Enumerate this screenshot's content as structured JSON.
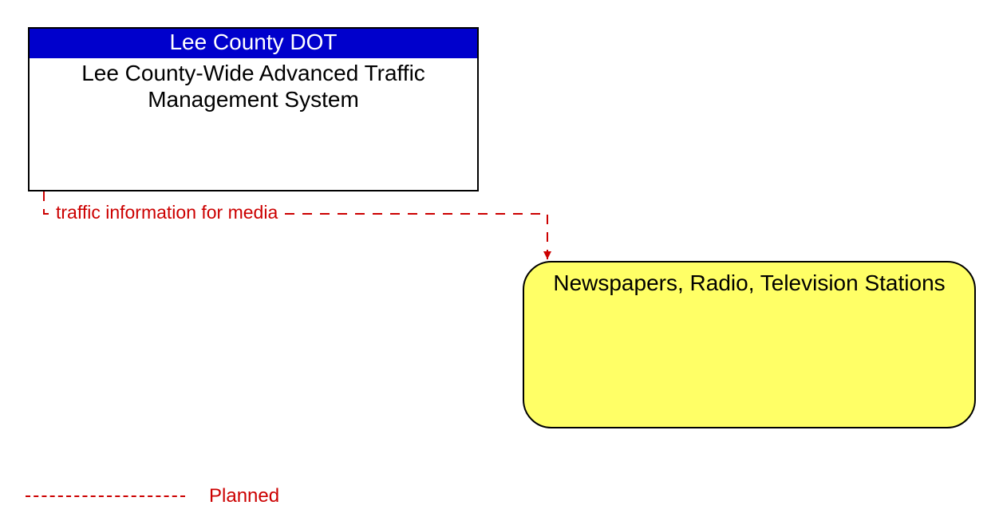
{
  "source": {
    "owner": "Lee County DOT",
    "name": "Lee County-Wide Advanced Traffic Management System"
  },
  "target": {
    "name": "Newspapers, Radio, Television Stations"
  },
  "flow": {
    "label": "traffic information for media",
    "status": "Planned"
  },
  "legend": {
    "planned_label": "Planned"
  },
  "colors": {
    "header_bg": "#0000cc",
    "planned_line": "#cc0000",
    "target_fill": "#ffff66"
  }
}
